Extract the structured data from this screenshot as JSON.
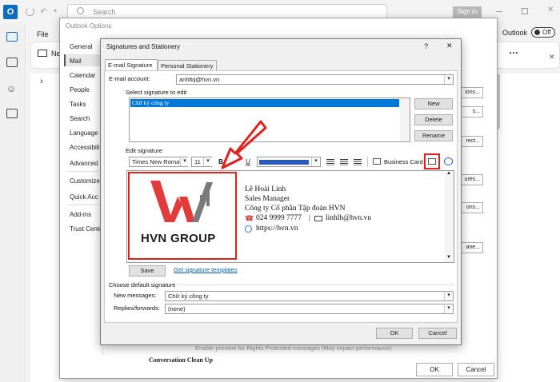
{
  "outlook": {
    "logo_letter": "O",
    "search_placeholder": "Search",
    "signin_label": "Sign in",
    "file_tab": "File",
    "new_label": "Ne",
    "toggle_outlook_label": "Outlook",
    "toggle_state": "Off",
    "more_label": "…",
    "expand_chevron": "›"
  },
  "options": {
    "title": "Outlook Options",
    "nav": [
      "General",
      "Mail",
      "Calendar",
      "People",
      "Tasks",
      "Search",
      "Language",
      "Accessibili",
      "Advanced",
      "Customize",
      "Quick Acc",
      "Add-ins",
      "Trust Cente"
    ],
    "side_buttons": [
      "ions...",
      "s...",
      "rect...",
      "ures...",
      "ons...",
      "ane..."
    ],
    "faded_text": "Enable preview for Rights Protected messages (May impact performance)",
    "conversation_heading": "Conversation Clean Up",
    "ok": "OK",
    "cancel": "Cancel"
  },
  "dialog": {
    "title": "Signatures and Stationery",
    "help": "?",
    "close": "✕",
    "tabs": [
      "E-mail Signature",
      "Personal Stationery"
    ],
    "email_account_label": "E-mail account:",
    "email_account_value": "anhltq@hvn.vn",
    "select_label": "Select signature to edit",
    "signatures": [
      "Chữ ký công ty"
    ],
    "buttons": {
      "new": "New",
      "delete": "Delete",
      "rename": "Rename"
    },
    "edit_label": "Edit signature",
    "toolbar": {
      "font": "Times New Roman",
      "size": "11",
      "bold": "B",
      "italic": "I",
      "underline": "U",
      "color_hex": "#2b5cb8",
      "business_card": "Business Card"
    },
    "signature_content": {
      "name": "Lê Hoài Linh",
      "position": "Sales Manager",
      "company": "Công ty Cổ phần Tập đoàn HVN",
      "phone": "024 9999 7777",
      "separator": "|",
      "email": "linhlh@hvn.vn",
      "website": "https://hvn.vn",
      "logo_text": "HVN GROUP"
    },
    "save": "Save",
    "templates_link": "Get signature templates",
    "default_heading": "Choose default signature",
    "new_messages_label": "New messages:",
    "new_messages_value": "Chữ ký công ty",
    "replies_label": "Replies/forwards:",
    "replies_value": "(none)",
    "ok": "OK",
    "cancel": "Cancel"
  },
  "colors": {
    "highlight_red": "#e0211b",
    "selection_blue": "#0078d7",
    "logo_red": "#e23b3b",
    "logo_gray": "#7a7a7a"
  }
}
